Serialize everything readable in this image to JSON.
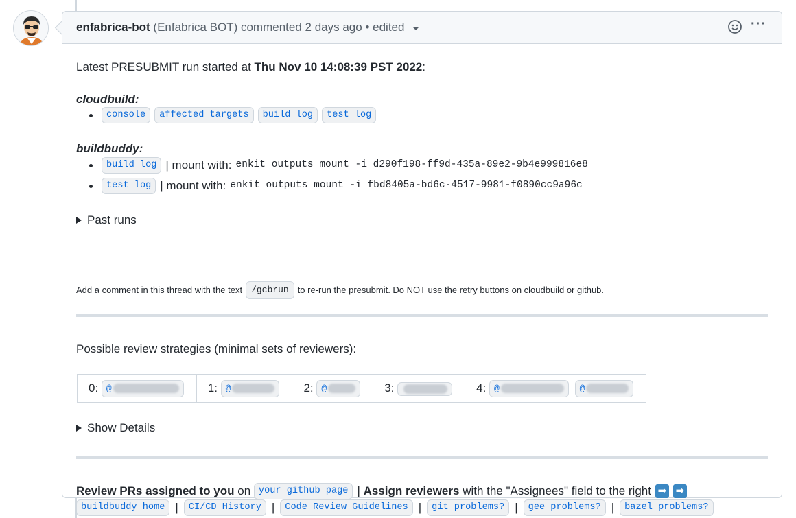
{
  "comment": {
    "author": "enfabrica-bot",
    "author_full": "(Enfabrica BOT)",
    "commented": "commented",
    "time": "2 days ago",
    "separator": "•",
    "edited": "edited"
  },
  "presubmit": {
    "intro": "Latest PRESUBMIT run started at",
    "timestamp": "Thu Nov 10 14:08:39 PST 2022",
    "colon": ":"
  },
  "cloudbuild": {
    "heading": "cloudbuild:",
    "links": [
      "console",
      "affected targets",
      "build log",
      "test log"
    ]
  },
  "buildbuddy": {
    "heading": "buildbuddy:",
    "items": [
      {
        "link": "build log",
        "mount_label": "| mount with:",
        "command": "enkit outputs mount -i d290f198-ff9d-435a-89e2-9b4e999816e8"
      },
      {
        "link": "test log",
        "mount_label": "| mount with:",
        "command": "enkit outputs mount -i fbd8405a-bd6c-4517-9981-f0890cc9a96c"
      }
    ]
  },
  "past_runs": "Past runs",
  "rerun_note": {
    "before": "Add a comment in this thread with the text",
    "code": "/gcbrun",
    "after": "to re-run the presubmit. Do NOT use the retry buttons on cloudbuild or github."
  },
  "strategies": {
    "label": "Possible review strategies (minimal sets of reviewers):",
    "options": [
      {
        "index": "0:",
        "mentions": [
          "@"
        ]
      },
      {
        "index": "1:",
        "mentions": [
          "@"
        ]
      },
      {
        "index": "2:",
        "mentions": [
          "@"
        ]
      },
      {
        "index": "3:",
        "mentions": [
          ""
        ]
      },
      {
        "index": "4:",
        "mentions": [
          "@",
          "@"
        ]
      }
    ]
  },
  "show_details": "Show Details",
  "footer": {
    "review_prs": "Review PRs assigned to you",
    "on": "on",
    "github_page": "your github page",
    "pipe": "|",
    "assign_reviewers": "Assign reviewers",
    "assign_text": "with the \"Assignees\" field to the right",
    "arrow": "➡",
    "links": [
      "buildbuddy home",
      "CI/CD History",
      "Code Review Guidelines",
      "git problems?",
      "gee problems?",
      "bazel problems?"
    ]
  },
  "colors": {
    "link": "#0969da",
    "border": "#d0d7de",
    "header_bg": "#f6f8fa",
    "text": "#24292f",
    "muted": "#57606a"
  }
}
